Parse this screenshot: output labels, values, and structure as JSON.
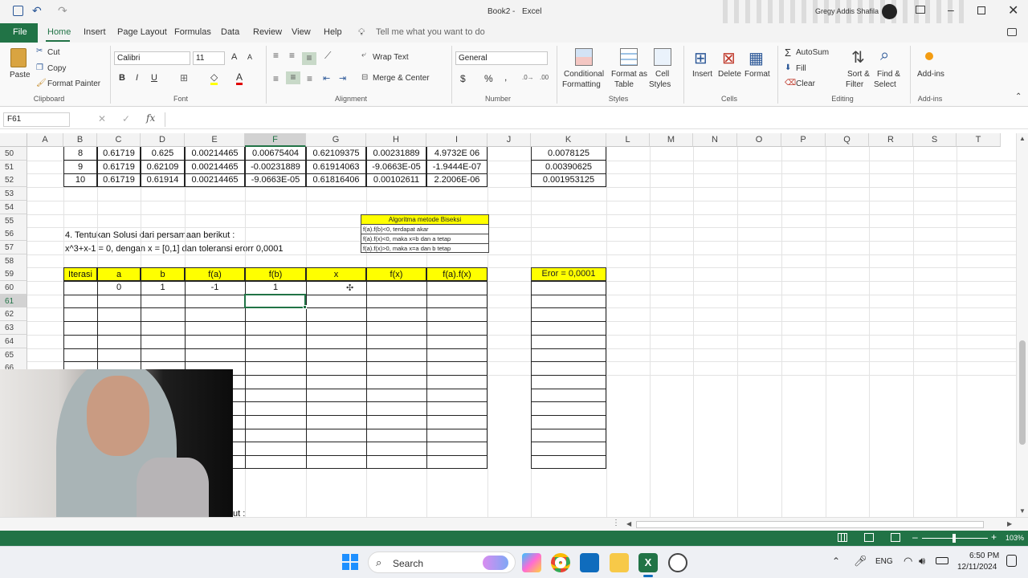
{
  "app": {
    "doc_title": "Book2",
    "app_name": "Excel",
    "user": "Gregy Addis Shafila"
  },
  "tabs": [
    "File",
    "Home",
    "Insert",
    "Page Layout",
    "Formulas",
    "Data",
    "Review",
    "View",
    "Help"
  ],
  "tell_me": "Tell me what you want to do",
  "ribbon": {
    "clipboard": {
      "paste": "Paste",
      "cut": "Cut",
      "copy": "Copy",
      "painter": "Format Painter",
      "group": "Clipboard"
    },
    "font": {
      "name": "Calibri",
      "size": "11",
      "group": "Font"
    },
    "alignment": {
      "wrap": "Wrap Text",
      "merge": "Merge & Center",
      "group": "Alignment"
    },
    "number": {
      "format": "General",
      "group": "Number"
    },
    "styles": {
      "cond1": "Conditional",
      "cond2": "Formatting",
      "fmt1": "Format as",
      "fmt2": "Table",
      "cell1": "Cell",
      "cell2": "Styles",
      "group": "Styles"
    },
    "cells": {
      "insert": "Insert",
      "delete": "Delete",
      "format": "Format",
      "group": "Cells"
    },
    "editing": {
      "autosum": "AutoSum",
      "fill": "Fill",
      "clear": "Clear",
      "sort1": "Sort &",
      "sort2": "Filter",
      "find1": "Find &",
      "find2": "Select",
      "group": "Editing"
    },
    "addins": {
      "label": "Add-ins",
      "group": "Add-ins"
    }
  },
  "namebox": "F61",
  "columns": [
    "A",
    "B",
    "C",
    "D",
    "E",
    "F",
    "G",
    "H",
    "I",
    "J",
    "K",
    "L",
    "M",
    "N",
    "O",
    "P",
    "Q",
    "R",
    "S",
    "T"
  ],
  "rows": [
    "50",
    "51",
    "52",
    "53",
    "54",
    "55",
    "56",
    "57",
    "58",
    "59",
    "60",
    "61",
    "62",
    "63",
    "64",
    "65",
    "66"
  ],
  "table_top": [
    [
      "8",
      "0.61719",
      "0.625",
      "0.00214465",
      "0.00675404",
      "0.62109375",
      "0.00231889",
      "4.9732E 06",
      "0.0078125"
    ],
    [
      "9",
      "0.61719",
      "0.62109",
      "0.00214465",
      "-0.00231889",
      "0.61914063",
      "-9.0663E-05",
      "-1.9444E-07",
      "0.00390625"
    ],
    [
      "10",
      "0.61719",
      "0.61914",
      "0.00214465",
      "-9.0663E-05",
      "0.61816406",
      "0.00102611",
      "2.2006E-06",
      "0.001953125"
    ]
  ],
  "question": {
    "line1": "4. Tentukan Solusi dari persamaan berikut :",
    "line2": "x^3+x-1 = 0, dengan x = [0,1] dan toleransi erorr 0,0001"
  },
  "algo": {
    "title": "Algoritma metode Biseksi",
    "l1": "f(a).f(b)<0, terdapat akar",
    "l2": "f(a).f(x)<0, maka x=b dan a tetap",
    "l3": "f(a).f(x)>0, maka x=a dan b tetap"
  },
  "headers": [
    "Iterasi",
    "a",
    "b",
    "f(a)",
    "f(b)",
    "x",
    "f(x)",
    "f(a).f(x)"
  ],
  "row60": [
    "",
    "0",
    "1",
    "-1",
    "1",
    "",
    "",
    ""
  ],
  "error_label": "Eror = 0,0001",
  "partial_text": "ut :",
  "zoom": "103%",
  "taskbar": {
    "search": "Search",
    "lang": "ENG",
    "time": "6:50 PM",
    "date": "12/11/2024"
  }
}
